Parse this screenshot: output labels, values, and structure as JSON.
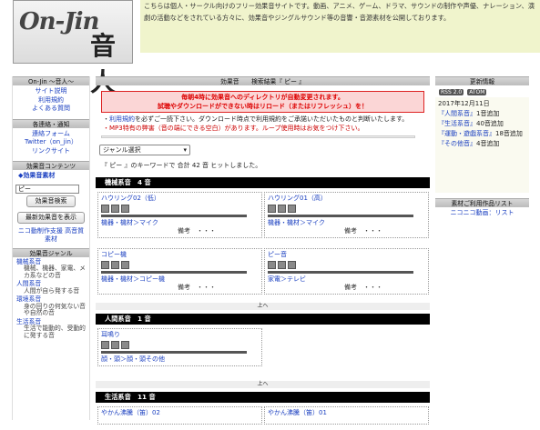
{
  "header": {
    "logo_text": "On-Jin 音人",
    "intro": "こちらは個人・サークル向けのフリー効果音サイトです。動画、アニメ、ゲーム、ドラマ、サウンドの制作や声優、ナレーション、演劇の活動などをされている方々に、効果音やジングルサウンド等の音響・音源素材を公開しております。"
  },
  "left": {
    "site_head": "On-Jin ～音人～",
    "site_links": [
      "サイト説明",
      "利用規約",
      "よくある質問"
    ],
    "contact_head": "各連絡・通知",
    "contact_links": [
      "連絡フォーム",
      "Twitter（on_jin）",
      "リンクサイト"
    ],
    "content_head": "効果音コンテンツ",
    "content_link": "◆効果音素材",
    "search_value": "ピー",
    "search_button": "効果音検索",
    "newest_button": "最新効果音を表示",
    "nico": "ニコ動制作支援 高音質素材",
    "genre_head": "効果音ジャンル",
    "genres": [
      {
        "name": "機械系音",
        "desc": "機械、機器、家電、メカ系などの音"
      },
      {
        "name": "人間系音",
        "desc": "人間が自ら発する音"
      },
      {
        "name": "環境系音",
        "desc": "身の回りの何気ない音や自然の音"
      },
      {
        "name": "生活系音",
        "desc": "生活で能動的、受動的に発する音"
      }
    ]
  },
  "main": {
    "title_label": "効果音",
    "title_result": "検索結果『 ピー 』",
    "notice1": "毎朝4時に効果音へのディレクトリが自動変更されます。",
    "notice2": "試聴やダウンロードができない時はリロード（またはリフレッシュ）を！",
    "bullet1_link": "利用規約",
    "bullet1_text": "を必ずご一読下さい。ダウンロード時点で利用規約をご承諾いただいたものと判断いたします。",
    "bullet2": "MP3特有の弊害（音の端にできる空白）があります。ループ使用時はお気をつけ下さい。",
    "genre_select": "ジャンル選択",
    "result_text": "『 ピー 』のキーワードで 合計 42 音 ヒットしました。",
    "back_top": "上へ",
    "memo": "備考　・・・",
    "categories": [
      {
        "title": "機械系音　4 音",
        "items": [
          {
            "name": "ハウリング02（低）",
            "path": "機器・機材＞マイク"
          },
          {
            "name": "ハウリング01（高）",
            "path": "機器・機材＞マイク"
          },
          {
            "name": "コピー機",
            "path": "機器・機材＞コピー機"
          },
          {
            "name": "ピー音",
            "path": "家電＞テレビ"
          }
        ]
      },
      {
        "title": "人間系音　1 音",
        "items": [
          {
            "name": "耳鳴り",
            "path": "顔・頭＞顔・頭その他"
          }
        ]
      },
      {
        "title": "生活系音　11 音",
        "items": [
          {
            "name": "やかん沸騰（笛）02",
            "path": ""
          },
          {
            "name": "やかん沸騰（笛）01",
            "path": ""
          }
        ]
      }
    ]
  },
  "right": {
    "update_head": "更新情報",
    "rss": "RSS 2.0",
    "atom": "ATOM",
    "date": "2017年12月11日",
    "updates": [
      {
        "cat": "『人間系音』",
        "text": "1音追加"
      },
      {
        "cat": "『生活系音』",
        "text": "40音追加"
      },
      {
        "cat": "『運動・遊戯系音』",
        "text": "18音追加"
      },
      {
        "cat": "『その他音』",
        "text": "4音追加"
      }
    ],
    "works_head": "素材ご利用作品リスト",
    "works_link": "ニコニコ動画：リスト"
  }
}
